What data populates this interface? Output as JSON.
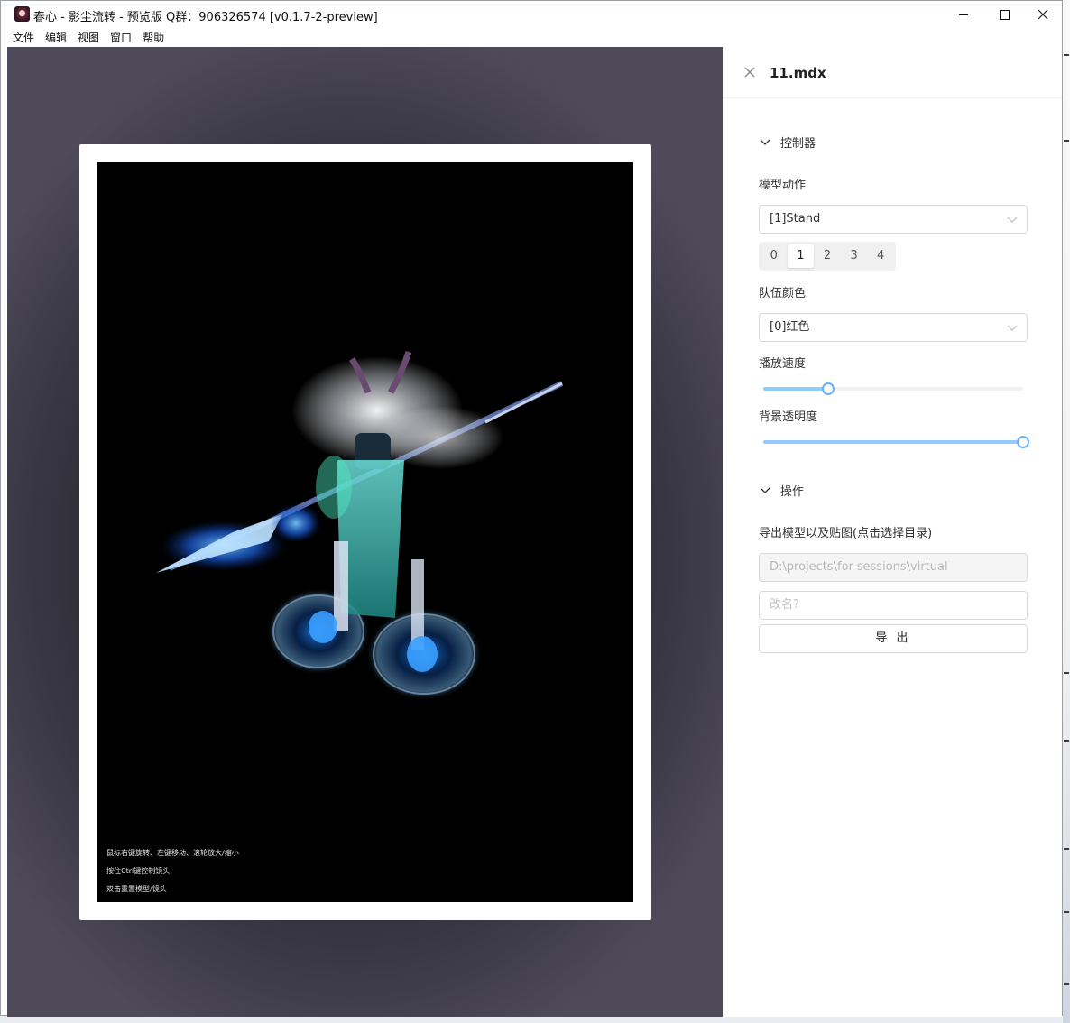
{
  "window": {
    "title": "春心 - 影尘流转 - 预览版 Q群：906326574 [v0.1.7-2-preview]"
  },
  "menu": [
    "文件",
    "编辑",
    "视图",
    "窗口",
    "帮助"
  ],
  "viewer": {
    "hints": [
      "鼠标右键旋转、左键移动、滚轮放大/缩小",
      "按住Ctrl键控制镜头",
      "双击重置模型/镜头"
    ]
  },
  "panel": {
    "file_name": "11.mdx",
    "controller": {
      "section_title": "控制器",
      "animation_label": "模型动作",
      "animation_value": "[1]Stand",
      "variants": [
        "0",
        "1",
        "2",
        "3",
        "4"
      ],
      "variant_selected": "1",
      "team_color_label": "队伍颜色",
      "team_color_value": "[0]红色",
      "speed_label": "播放速度",
      "speed_value": 0.25,
      "bg_opacity_label": "背景透明度",
      "bg_opacity_value": 1.0
    },
    "operations": {
      "section_title": "操作",
      "export_label": "导出模型以及贴图(点击选择目录)",
      "path_value": "D:\\projects\\for-sessions\\virtual",
      "rename_placeholder": "改名?",
      "export_button": "导 出"
    }
  },
  "colors": {
    "accent": "#69b1ff",
    "accent_track": "#91caff"
  }
}
